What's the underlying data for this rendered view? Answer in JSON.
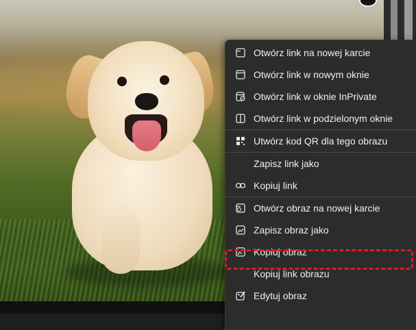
{
  "menu": {
    "items": [
      {
        "label": "Otwórz link na nowej karcie",
        "icon": "new-tab-icon"
      },
      {
        "label": "Otwórz link w nowym oknie",
        "icon": "new-window-icon"
      },
      {
        "label": "Otwórz link w oknie InPrivate",
        "icon": "inprivate-window-icon"
      },
      {
        "label": "Otwórz link w podzielonym oknie",
        "icon": "split-window-icon"
      },
      {
        "label": "Utwórz kod QR dla tego obrazu",
        "icon": "qr-code-icon"
      },
      {
        "label": "Zapisz link jako",
        "icon": ""
      },
      {
        "label": "Kopiuj link",
        "icon": "link-icon"
      },
      {
        "label": "Otwórz obraz na nowej karcie",
        "icon": "image-new-tab-icon"
      },
      {
        "label": "Zapisz obraz jako",
        "icon": "save-image-icon"
      },
      {
        "label": "Kopiuj obraz",
        "icon": "copy-image-icon"
      },
      {
        "label": "Kopiuj link obrazu",
        "icon": ""
      },
      {
        "label": "Edytuj obraz",
        "icon": "edit-image-icon"
      }
    ]
  },
  "colors": {
    "menu_bg": "#2c2c2c",
    "menu_text": "#f0f0f0",
    "highlight": "#e01b24"
  }
}
